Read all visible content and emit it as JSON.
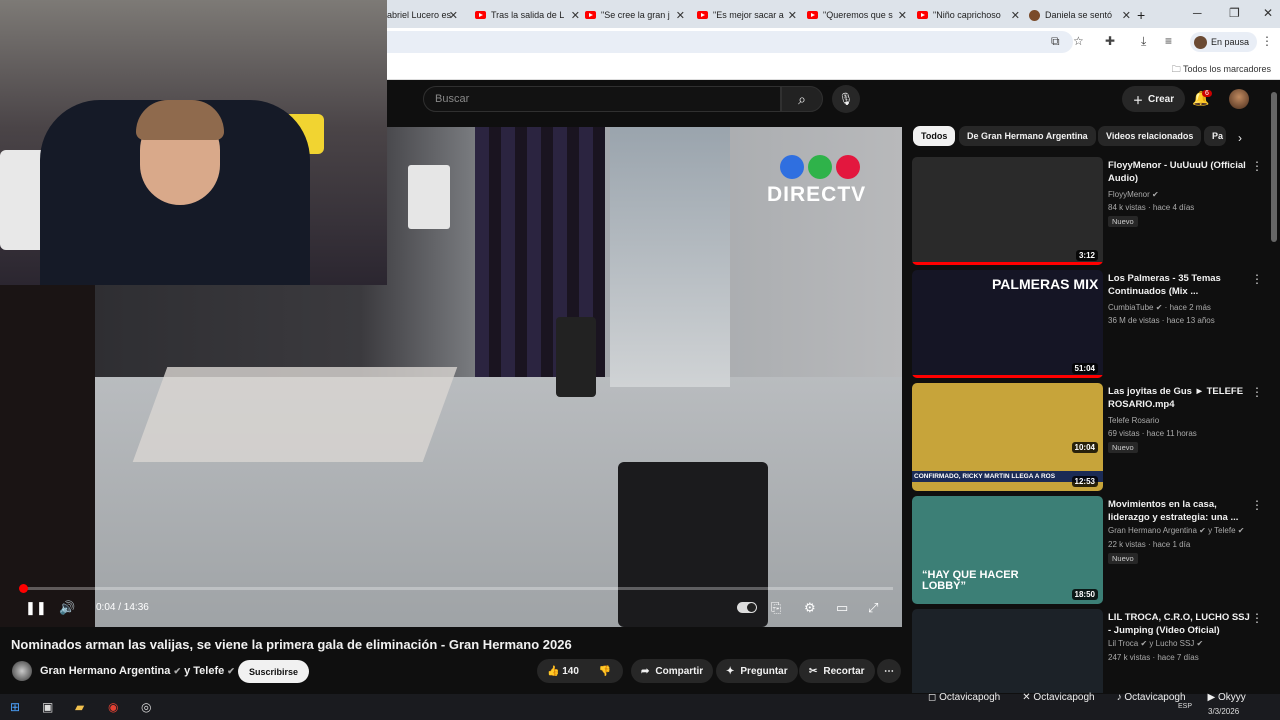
{
  "browser": {
    "tabs": [
      {
        "label": "abriel Lucero es",
        "icon": "avatar"
      },
      {
        "label": "Tras la salida de L",
        "icon": "youtube"
      },
      {
        "label": "\"Se cree la gran j",
        "icon": "youtube"
      },
      {
        "label": "\"Es mejor sacar a",
        "icon": "youtube"
      },
      {
        "label": "\"Queremos que s",
        "icon": "youtube"
      },
      {
        "label": "\"Niño caprichoso",
        "icon": "youtube"
      },
      {
        "label": "Daniela se sentó",
        "icon": "avatar"
      }
    ],
    "new_tab": "+",
    "profile_status": "En pausa",
    "bookmarks_all": "Todos los marcadores"
  },
  "masthead": {
    "search_placeholder": "Buscar",
    "create_label": "Crear",
    "notifications_count": "6"
  },
  "video": {
    "overlay_brand": "DIRECTV",
    "brand_colors": [
      "#2f6fe0",
      "#2fb34a",
      "#e3173e"
    ],
    "current_time": "0:04 / 14:36",
    "progress": 0.005,
    "title": "Nominados arman las valijas, se viene la primera gala de eliminación - Gran Hermano 2026",
    "channel": "Gran Hermano Argentina",
    "channel_suffix": "y Telefe",
    "subscribe_label": "Suscribirse",
    "likes": "140",
    "share_label": "Compartir",
    "ask_label": "Preguntar",
    "clip_label": "Recortar"
  },
  "chips": [
    "Todos",
    "De Gran Hermano Argentina",
    "Videos relacionados",
    "Pa"
  ],
  "recommendations": [
    {
      "title": "FloyyMenor - UuUuuU (Official Audio)",
      "channel": "FloyyMenor",
      "meta": "84 k vistas · hace 4 días",
      "badge": "Nuevo",
      "duration": "3:12",
      "thumb": "#2a2a2a"
    },
    {
      "title": "Los Palmeras - 35 Temas Continuados (Mix ...",
      "channel": "CumbiaTube",
      "channel_extra": " · hace 2 más",
      "meta": "36 M de vistas · hace 13 años",
      "badge": "",
      "duration": "51:04",
      "thumb": "#151525"
    },
    {
      "title": "Las joyitas de Gus ► TELEFE ROSARIO.mp4",
      "channel": "Telefe Rosario",
      "meta": "69 vistas · hace 11 horas",
      "badge": "Nuevo",
      "duration": "10:04",
      "thumb": "#c7a43a"
    },
    {
      "title": "Movimientos en la casa, liderazgo y estrategia: una ...",
      "channel": "Gran Hermano Argentina",
      "channel_extra": " y Telefe",
      "meta": "22 k vistas · hace 1 día",
      "badge": "Nuevo",
      "duration": "18:50",
      "thumb": "#3c7f76"
    },
    {
      "title": "LIL TROCA, C.R.O, LUCHO SSJ - Jumping (Video Oficial)",
      "channel": "Lil Troca",
      "channel_extra": " y Lucho SSJ",
      "meta": "247 k vistas · hace 7 días",
      "badge": "",
      "duration": "",
      "thumb": "#1c2228"
    }
  ],
  "thumb_texts": {
    "palmeras": "PALMERAS MIX",
    "rosario_banner": "CONFIRMADO, RICKY MARTIN LLEGA A ROS",
    "lobby": "“HAY QUE HACER LOBBY”",
    "rosario_time": "12:53"
  },
  "overlay_socials": [
    "Octavicapogh",
    "Octavicapogh",
    "Octavicapogh",
    "Okyyy"
  ],
  "taskbar": {
    "lang": "ESP",
    "date": "3/3/2026"
  }
}
